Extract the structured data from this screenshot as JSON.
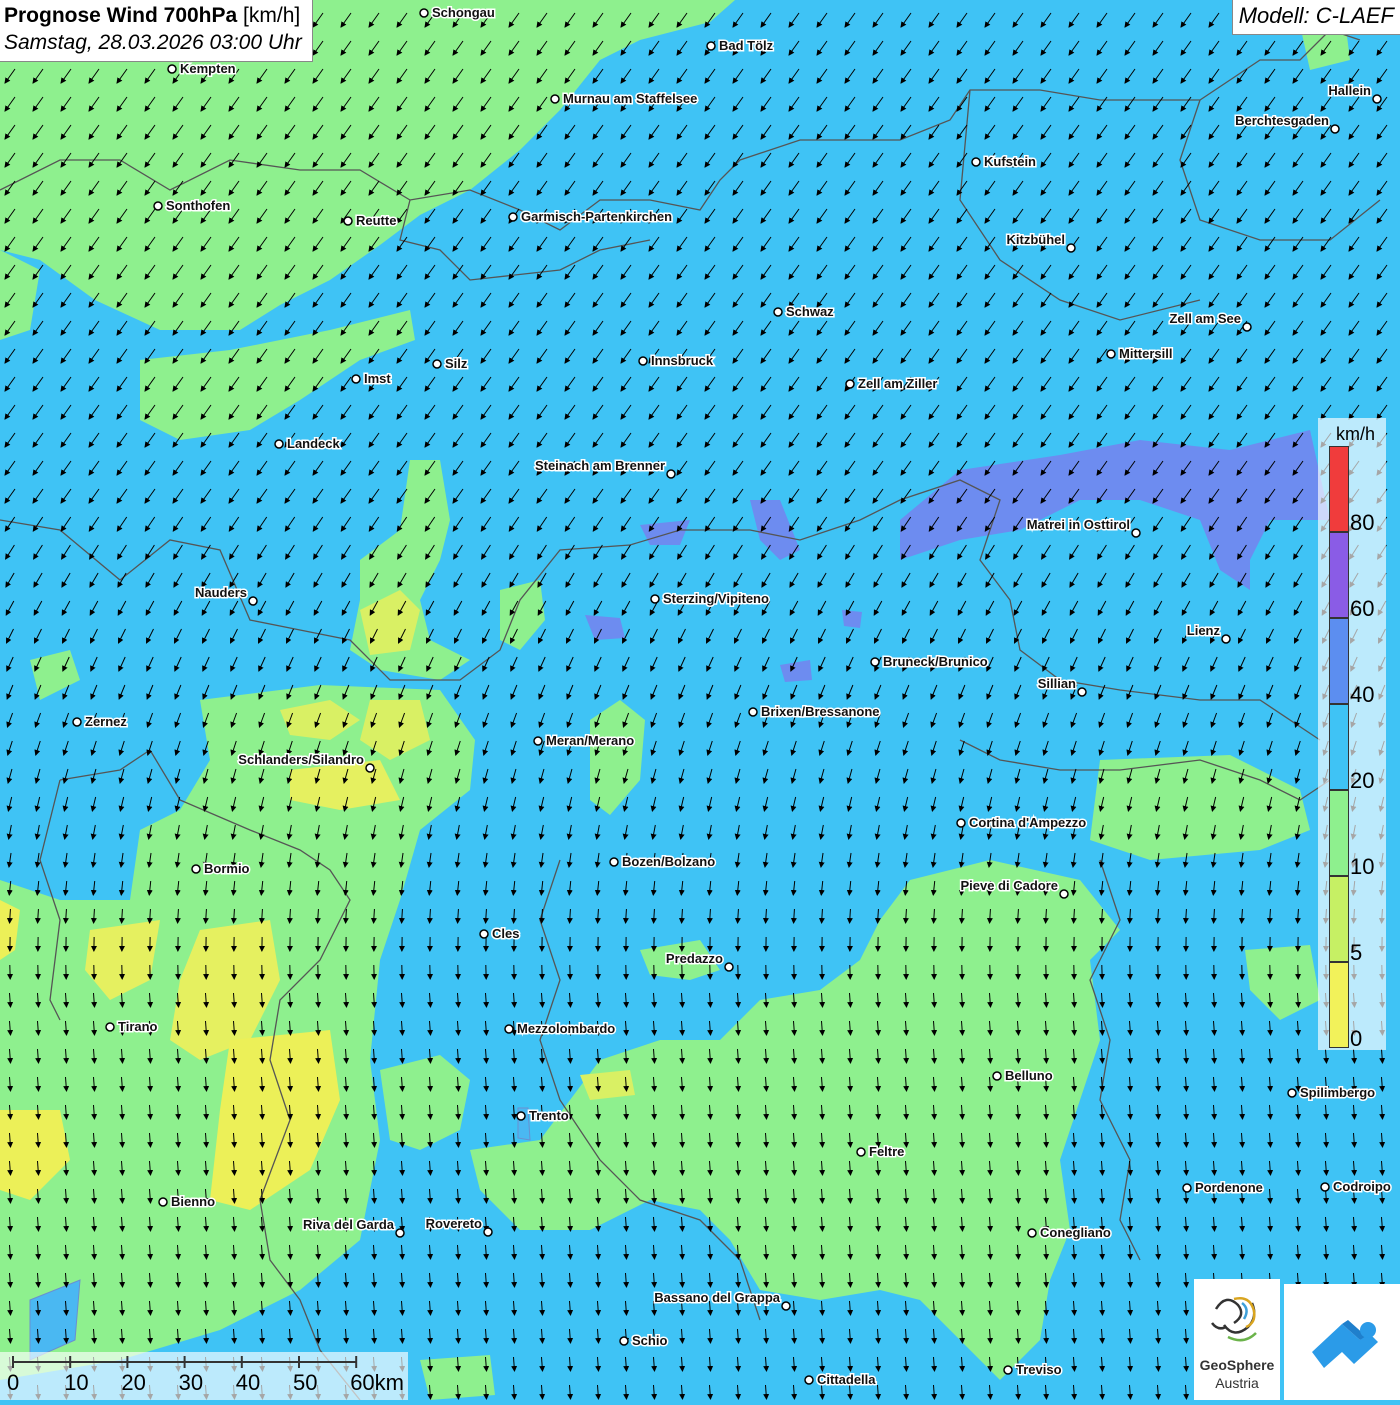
{
  "header": {
    "title_bold": "Prognose Wind 700hPa",
    "title_unit": "[km/h]",
    "datetime": "Samstag, 28.03.2026 03:00 Uhr",
    "model": "Modell: C-LAEF"
  },
  "legend": {
    "unit": "km/h",
    "labels": [
      "0",
      "5",
      "10",
      "20",
      "40",
      "60",
      "80"
    ],
    "colors": [
      "#f2f25a",
      "#c6f064",
      "#8ef08e",
      "#3fc3f5",
      "#5c8ef0",
      "#8a5ce6",
      "#f03c3c"
    ]
  },
  "scale": {
    "labels": [
      "0",
      "10",
      "20",
      "30",
      "40",
      "50",
      "60km"
    ]
  },
  "cities": [
    {
      "name": "Schongau"
    },
    {
      "name": "Bad Tölz"
    },
    {
      "name": "Kempten"
    },
    {
      "name": "Murnau am Staffelsee"
    },
    {
      "name": "Hallein"
    },
    {
      "name": "Berchtesgaden"
    },
    {
      "name": "Kufstein"
    },
    {
      "name": "Sonthofen"
    },
    {
      "name": "Reutte"
    },
    {
      "name": "Garmisch-Partenkirchen"
    },
    {
      "name": "Kitzbühel"
    },
    {
      "name": "Schwaz"
    },
    {
      "name": "Zell am See"
    },
    {
      "name": "Mittersill"
    },
    {
      "name": "Silz"
    },
    {
      "name": "Innsbruck"
    },
    {
      "name": "Imst"
    },
    {
      "name": "Zell am Ziller"
    },
    {
      "name": "Landeck"
    },
    {
      "name": "Steinach am Brenner"
    },
    {
      "name": "Matrei in Osttirol"
    },
    {
      "name": "Nauders"
    },
    {
      "name": "Sterzing/Vipiteno"
    },
    {
      "name": "Lienz"
    },
    {
      "name": "Bruneck/Brunico"
    },
    {
      "name": "Sillian"
    },
    {
      "name": "Zernez"
    },
    {
      "name": "Brixen/Bressanone"
    },
    {
      "name": "Meran/Merano"
    },
    {
      "name": "Schlanders/Silandro"
    },
    {
      "name": "Cortina d'Ampezzo"
    },
    {
      "name": "Bozen/Bolzano"
    },
    {
      "name": "Bormio"
    },
    {
      "name": "Pieve di Cadore"
    },
    {
      "name": "Cles"
    },
    {
      "name": "Predazzo"
    },
    {
      "name": "Tirano"
    },
    {
      "name": "Mezzolombardo"
    },
    {
      "name": "Belluno"
    },
    {
      "name": "Spilimbergo"
    },
    {
      "name": "Trento"
    },
    {
      "name": "Feltre"
    },
    {
      "name": "Pordenone"
    },
    {
      "name": "Codroipo"
    },
    {
      "name": "Bienno"
    },
    {
      "name": "Riva del Garda"
    },
    {
      "name": "Rovereto"
    },
    {
      "name": "Conegliano"
    },
    {
      "name": "Bassano del Grappa"
    },
    {
      "name": "Schio"
    },
    {
      "name": "Treviso"
    },
    {
      "name": "Cittadella"
    }
  ],
  "logos": {
    "agency_name": "GeoSphere",
    "agency_country": "Austria",
    "app_icon": "cloud-wind-app-icon",
    "agency_icon": "geosphere-swirl-icon"
  }
}
